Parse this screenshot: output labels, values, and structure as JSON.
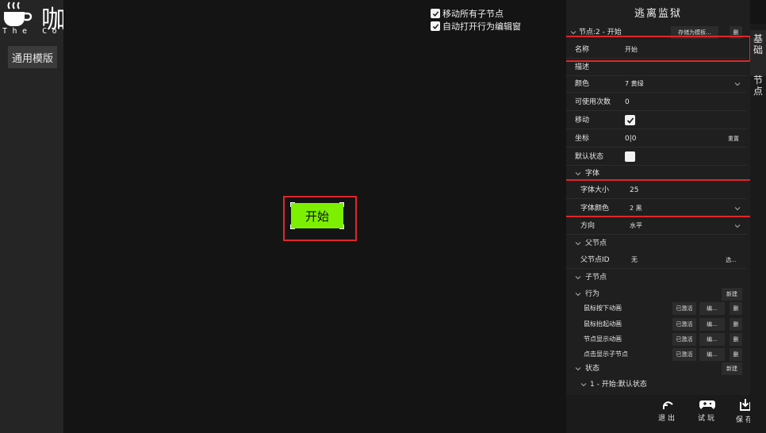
{
  "logo": {
    "title": "咖啡剧场",
    "subtitle": "The Coffee theater"
  },
  "sidebar": {
    "template_button": "通用模版"
  },
  "canvas": {
    "options": [
      {
        "label": "移动所有子节点",
        "checked": true
      },
      {
        "label": "自动打开行为编辑窗",
        "checked": true
      }
    ],
    "node_label": "开始",
    "node_color": "#7cf000"
  },
  "panel": {
    "title": "逃离监狱",
    "node_header": "节点:2 - 开始",
    "save_template": "存储为模板...",
    "delete": "删",
    "fields": {
      "name_label": "名称",
      "name_value": "开始",
      "desc_label": "描述",
      "color_label": "颜色",
      "color_value": "7 黄绿",
      "uses_label": "可使用次数",
      "uses_value": "0",
      "move_label": "移动",
      "move_checked": true,
      "coord_label": "坐标",
      "coord_value": "0|0",
      "reset": "重置",
      "default_label": "默认状态",
      "default_checked": false
    },
    "font_section": "字体",
    "font_size_label": "字体大小",
    "font_size_value": "25",
    "font_color_label": "字体颜色",
    "font_color_value": "2 黑",
    "direction_label": "方向",
    "direction_value": "水平",
    "parent_section": "父节点",
    "parent_id_label": "父节点ID",
    "parent_id_value": "无",
    "choose": "选...",
    "children_section": "子节点",
    "behavior_section": "行为",
    "new": "新建",
    "behaviors": [
      {
        "name": "鼠标按下动画",
        "status": "已激活",
        "edit": "编...",
        "del": "删"
      },
      {
        "name": "鼠标抬起动画",
        "status": "已激活",
        "edit": "编...",
        "del": "删"
      },
      {
        "name": "节点显示动画",
        "status": "已激活",
        "edit": "编...",
        "del": "删"
      },
      {
        "name": "点击显示子节点",
        "status": "已激活",
        "edit": "编...",
        "del": "删"
      }
    ],
    "state_section": "状态",
    "state_new": "新建",
    "state_item": "1 - 开始:默认状态",
    "bottom": {
      "exit": "退出",
      "test": "试玩",
      "save": "保存"
    }
  },
  "tabs": {
    "basic": "基础",
    "node": "节点"
  },
  "colors": {
    "highlight": "#e0262a",
    "panel_bg": "#1f1f1f",
    "canvas_bg": "#141414"
  }
}
